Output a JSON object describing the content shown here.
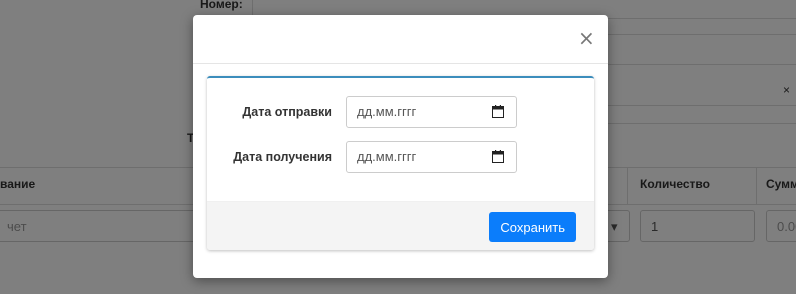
{
  "background": {
    "number_label": "Номер:",
    "t_label": "Т",
    "col_name_partial": "вание",
    "col_quantity": "Количество",
    "col_sum_partial": "Сумм",
    "name_input_partial": "чет",
    "quantity_value": "1",
    "sum_value_partial": "0.00",
    "clear_symbol": "×"
  },
  "modal": {
    "close_symbol": "×",
    "fields": [
      {
        "label": "Дата отправки",
        "placeholder": "дд.мм.гггг"
      },
      {
        "label": "Дата получения",
        "placeholder": "дд.мм.гггг"
      }
    ],
    "save_label": "Сохранить"
  },
  "colors": {
    "accent": "#0b7dfb",
    "panel_top_border": "#3c8dbc",
    "overlay": "rgba(0,0,0,0.5)"
  },
  "icons": [
    "close-icon",
    "calendar-icon"
  ]
}
